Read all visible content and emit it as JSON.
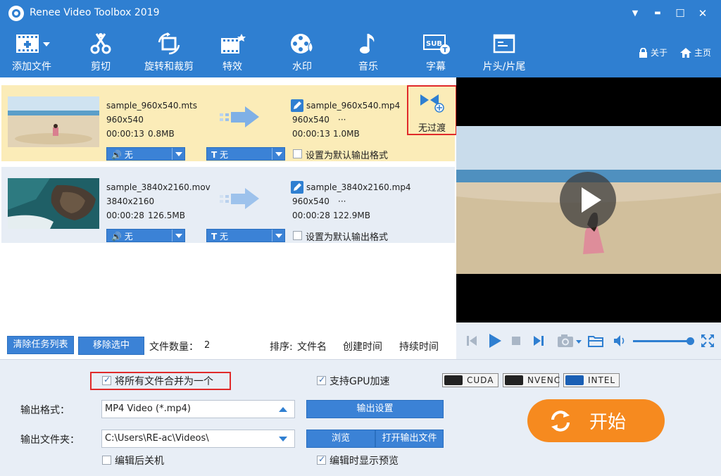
{
  "window": {
    "title": "Renee Video Toolbox 2019",
    "icon": "film-reel-icon",
    "minimize_icon": "▬",
    "restore_icon": "☐",
    "close_icon": "✕",
    "menu_icon": "▼"
  },
  "toolbar": {
    "items": [
      {
        "label": "添加文件",
        "icon": "film-add-icon"
      },
      {
        "label": "剪切",
        "icon": "scissors-icon"
      },
      {
        "label": "旋转和裁剪",
        "icon": "crop-rotate-icon"
      },
      {
        "label": "特效",
        "icon": "effects-icon"
      },
      {
        "label": "水印",
        "icon": "watermark-icon"
      },
      {
        "label": "音乐",
        "icon": "music-note-icon"
      },
      {
        "label": "字幕",
        "icon": "subtitle-icon"
      },
      {
        "label": "片头/片尾",
        "icon": "intro-outro-icon"
      }
    ],
    "about": "关于",
    "home": "主页"
  },
  "tasks": [
    {
      "src_name": "sample_960x540.mts",
      "src_res": "960x540",
      "src_dur": "00:00:13",
      "src_size": "0.8MB",
      "out_name": "sample_960x540.mp4",
      "out_res": "960x540",
      "out_more": "···",
      "out_dur": "00:00:13",
      "out_size": "1.0MB",
      "audio_label": "无",
      "subtitle_label": "无",
      "default_label": "设置为默认输出格式",
      "selected": true
    },
    {
      "src_name": "sample_3840x2160.mov",
      "src_res": "3840x2160",
      "src_dur": "00:00:28",
      "src_size": "126.5MB",
      "out_name": "sample_3840x2160.mp4",
      "out_res": "960x540",
      "out_more": "···",
      "out_dur": "00:00:28",
      "out_size": "122.9MB",
      "audio_label": "无",
      "subtitle_label": "无",
      "default_label": "设置为默认输出格式",
      "selected": false
    }
  ],
  "transition": {
    "label": "无过渡",
    "icon": "transition-icon"
  },
  "list_footer": {
    "clear_label": "清除任务列表",
    "remove_label": "移除选中",
    "count_label": "文件数量：",
    "count_value": "2",
    "sort_label": "排序:",
    "sort_name": "文件名",
    "sort_created": "创建时间",
    "sort_duration": "持续时间"
  },
  "bottom": {
    "merge_label": "将所有文件合并为一个",
    "merge_checked": true,
    "gpu_label": "支持GPU加速",
    "gpu_checked": true,
    "badges": [
      "CUDA",
      "NVENC",
      "INTEL"
    ],
    "format_label": "输出格式：",
    "format_value": "MP4 Video (*.mp4)",
    "output_settings": "输出设置",
    "folder_label": "输出文件夹：",
    "folder_value": "C:\\Users\\RE-ac\\Videos\\",
    "browse": "浏览",
    "open_folder": "打开输出文件",
    "shutdown_label": "编辑后关机",
    "shutdown_checked": false,
    "preview_label": "编辑时显示预览",
    "preview_checked": true,
    "start": "开始"
  },
  "colors": {
    "brand": "#2f7fd1",
    "selected_row": "#fbecb8",
    "row": "#e7edf5",
    "start": "#f68a1f",
    "highlight": "#e02a2a"
  }
}
